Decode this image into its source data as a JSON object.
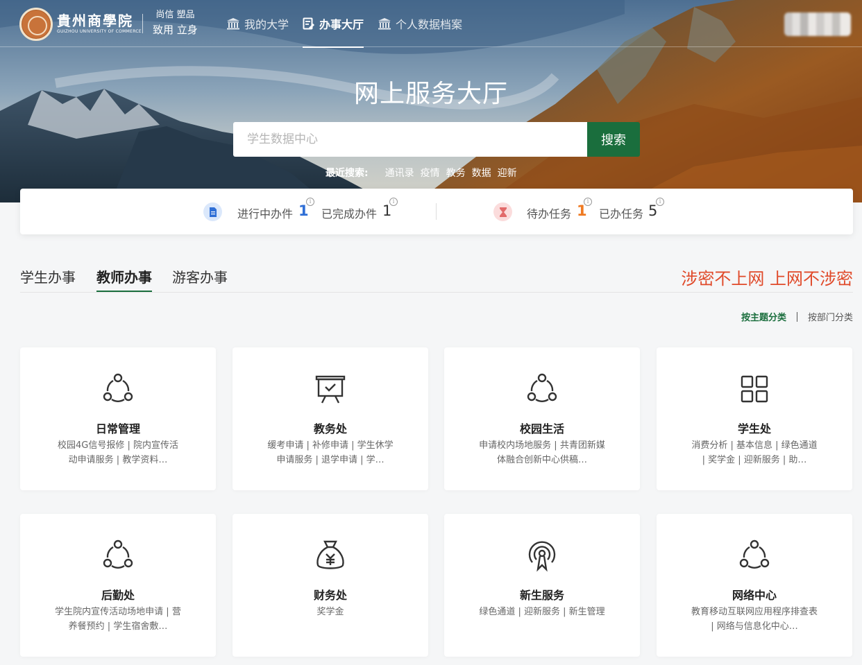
{
  "header": {
    "logo_name": "貴州商學院",
    "logo_sub": "GUIZHOU UNIVERSITY OF COMMERCE",
    "motto_line1": "尚信 塑品",
    "motto_line2": "致用 立身",
    "nav": [
      {
        "label": "我的大学",
        "icon": "bank-icon",
        "active": false
      },
      {
        "label": "办事大厅",
        "icon": "form-icon",
        "active": true
      },
      {
        "label": "个人数据档案",
        "icon": "bank-icon",
        "active": false
      }
    ]
  },
  "hero": {
    "title": "网上服务大厅",
    "search_placeholder": "学生数据中心",
    "search_button": "搜索",
    "recent_label": "最近搜索:",
    "recent_keywords": [
      "通讯录",
      "疫情",
      "教务",
      "数据",
      "迎新"
    ]
  },
  "stats": {
    "in_progress_label": "进行中办件",
    "in_progress_value": "1",
    "completed_label": "已完成办件",
    "completed_value": "1",
    "todo_label": "待办任务",
    "todo_value": "1",
    "done_label": "已办任务",
    "done_value": "5",
    "info_glyph": "i",
    "colors": {
      "blue": "#2f6fd6",
      "orange": "#ef7a22",
      "dark": "#333333"
    }
  },
  "tabs": {
    "items": [
      "学生办事",
      "教师办事",
      "游客办事"
    ],
    "active_index": 1,
    "warning": "涉密不上网 上网不涉密"
  },
  "classify": {
    "by_topic": "按主题分类",
    "by_department": "按部门分类"
  },
  "cards": [
    {
      "title": "日常管理",
      "icon": "share-icon",
      "desc": "校园4G信号报修 | 院内宣传活动申请服务 | 教学资料…"
    },
    {
      "title": "教务处",
      "icon": "presentation-icon",
      "desc": "缓考申请 | 补修申请 | 学生休学申请服务 | 退学申请 | 学…"
    },
    {
      "title": "校园生活",
      "icon": "share-icon",
      "desc": "申请校内场地服务 | 共青团新媒体融合创新中心供稿…"
    },
    {
      "title": "学生处",
      "icon": "grid-icon",
      "desc": "消费分析 | 基本信息 | 绿色通道 | 奖学金 | 迎新服务 | 助…"
    },
    {
      "title": "后勤处",
      "icon": "share-icon",
      "desc": "学生院内宣传活动场地申请 | 营养餐预约 | 学生宿舍敷…"
    },
    {
      "title": "财务处",
      "icon": "money-bag-icon",
      "desc": "奖学金"
    },
    {
      "title": "新生服务",
      "icon": "signal-icon",
      "desc": "绿色通道 | 迎新服务 | 新生管理"
    },
    {
      "title": "网络中心",
      "icon": "share-icon",
      "desc": "教育移动互联网应用程序排查表 | 网络与信息化中心…"
    }
  ],
  "theme": {
    "accent": "#1a6e3d",
    "warning": "#e04a2a"
  }
}
